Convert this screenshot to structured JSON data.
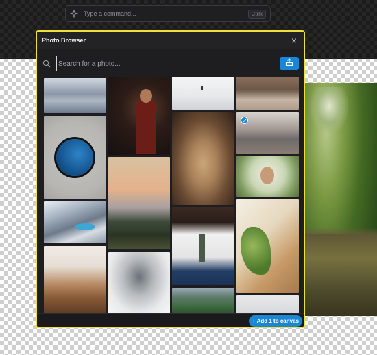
{
  "command_bar": {
    "placeholder": "Type a command...",
    "shortcut": "Ctrlk",
    "icon": "sparkle-icon"
  },
  "dialog": {
    "title": "Photo Browser",
    "close_icon": "close-icon",
    "search_placeholder": "Search for a photo...",
    "upload_icon": "upload-icon",
    "add_button_label": "+ Add 1 to canvas"
  },
  "photos": [
    {
      "name": "ocean-waves",
      "selected": false
    },
    {
      "name": "blue-circle-on-sand",
      "selected": false
    },
    {
      "name": "alpine-lake-aerial",
      "selected": false
    },
    {
      "name": "desert-hills-sunset",
      "selected": false
    },
    {
      "name": "woman-silhouette",
      "selected": false
    },
    {
      "name": "mountain-dusk",
      "selected": false
    },
    {
      "name": "misty-peak",
      "selected": false
    },
    {
      "name": "snow-field-figure",
      "selected": false
    },
    {
      "name": "lioness-portrait",
      "selected": false
    },
    {
      "name": "person-white-shirt",
      "selected": false
    },
    {
      "name": "green-valley",
      "selected": false
    },
    {
      "name": "boots-on-rocks",
      "selected": false
    },
    {
      "name": "city-street-crowd",
      "selected": true
    },
    {
      "name": "girl-flower-crown",
      "selected": false
    },
    {
      "name": "plant-and-sun",
      "selected": false
    },
    {
      "name": "light-bottom-tile",
      "selected": false
    }
  ],
  "colors": {
    "accent": "#1a86d6",
    "selection_border": "#f2e03a"
  }
}
